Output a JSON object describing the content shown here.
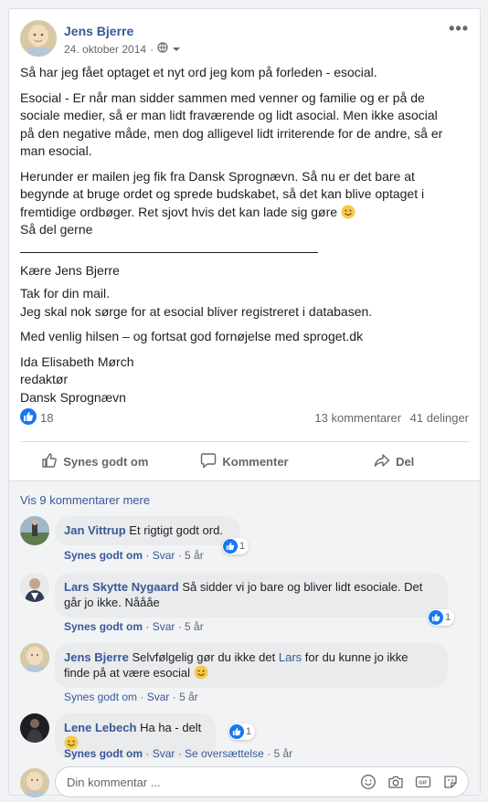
{
  "post": {
    "author": "Jens Bjerre",
    "date": "24. oktober 2014",
    "privacy_icon": "globe-icon",
    "more_icon": "•••",
    "body": {
      "p1": "Så har jeg fået optaget et nyt ord jeg kom på forleden - esocial.",
      "p2": [
        "Esocial - Er når man sidder sammen med venner og familie og er på de",
        "sociale medier, så er man lidt fraværende og lidt asocial. Men ikke asocial",
        "på den negative måde, men dog alligevel lidt irriterende for de andre, så er",
        "man esocial."
      ],
      "p3": [
        "Herunder er mailen jeg fik fra Dansk Sprognævn. Så nu er det bare at",
        "begynde at bruge ordet og sprede budskabet, så det kan blive optaget i",
        "fremtidige ordbøger. Ret sjovt hvis det kan lade sig gøre",
        "Så del gerne"
      ],
      "salutation": "Kære Jens Bjerre",
      "p4": [
        "Tak for din mail.",
        "Jeg skal nok sørge for at esocial bliver registreret i databasen."
      ],
      "p5": "Med venlig hilsen – og fortsat god fornøjelse med sproget.dk",
      "signature": [
        "Ida Elisabeth Mørch",
        "redaktør",
        "Dansk Sprognævn"
      ]
    }
  },
  "stats": {
    "likes": "18",
    "comments": "13 kommentarer",
    "shares": "41 delinger"
  },
  "actions": {
    "like": "Synes godt om",
    "comment": "Kommenter",
    "share": "Del"
  },
  "comments_section": {
    "view_more": "Vis 9 kommentarer mere",
    "comments": [
      {
        "name": "Jan Vittrup",
        "text": "Et rigtigt godt ord.",
        "reacts": "1",
        "like": "Synes godt om",
        "reply": "Svar",
        "time": "5 år"
      },
      {
        "name": "Lars Skytte Nygaard",
        "text1": "Så sidder vi jo bare og bliver lidt esociale. Det",
        "text2": "går jo ikke. Nåååe",
        "reacts": "1",
        "like": "Synes godt om",
        "reply": "Svar",
        "time": "5 år"
      },
      {
        "name": "Jens Bjerre",
        "text1a": "Selvfølgelig gør du ikke det",
        "link": "Lars",
        "text1b": "for du kunne jo ikke",
        "text2": "finde på at være esocial",
        "like": "Synes godt om",
        "reply": "Svar",
        "time": "5 år"
      },
      {
        "name": "Lene Lebech",
        "text": "Ha ha - delt",
        "reacts": "1",
        "like": "Synes godt om",
        "reply": "Svar",
        "translate": "Se oversættelse",
        "time": "5 år"
      }
    ],
    "compose_placeholder": "Din kommentar ..."
  },
  "colors": {
    "link": "#385898",
    "accent": "#1877f2",
    "muted": "#606770"
  }
}
